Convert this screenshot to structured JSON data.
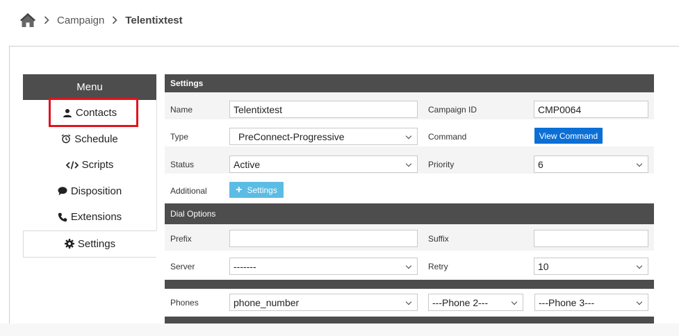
{
  "breadcrumb": {
    "items": [
      "Campaign"
    ],
    "current": "Telentixtest"
  },
  "menu": {
    "title": "Menu",
    "items": [
      {
        "label": "Contacts",
        "icon": "user-icon"
      },
      {
        "label": "Schedule",
        "icon": "alarm-clock-icon"
      },
      {
        "label": "Scripts",
        "icon": "code-icon"
      },
      {
        "label": "Disposition",
        "icon": "comment-icon"
      },
      {
        "label": "Extensions",
        "icon": "phone-icon"
      },
      {
        "label": "Settings",
        "icon": "gear-icon",
        "active": true
      }
    ]
  },
  "settings": {
    "title": "Settings",
    "name_label": "Name",
    "name_value": "Telentixtest",
    "campaign_id_label": "Campaign ID",
    "campaign_id_value": "CMP0064",
    "type_label": "Type",
    "type_value": "PreConnect-Progressive",
    "command_label": "Command",
    "command_button": "View Command",
    "status_label": "Status",
    "status_value": "Active",
    "priority_label": "Priority",
    "priority_value": "6",
    "additional_label": "Additional",
    "additional_button": "Settings"
  },
  "dial_options": {
    "title": "Dial Options",
    "prefix_label": "Prefix",
    "prefix_value": "",
    "suffix_label": "Suffix",
    "suffix_value": "",
    "server_label": "Server",
    "server_value": "-------",
    "retry_label": "Retry",
    "retry_value": "10"
  },
  "phones": {
    "label": "Phones",
    "phone1": "phone_number",
    "phone2": "---Phone 2---",
    "phone3": "---Phone 3---"
  },
  "colors": {
    "header_bg": "#4d4d4d",
    "primary": "#0b6fd6",
    "info": "#5bbce4",
    "highlight": "#e0141e"
  }
}
